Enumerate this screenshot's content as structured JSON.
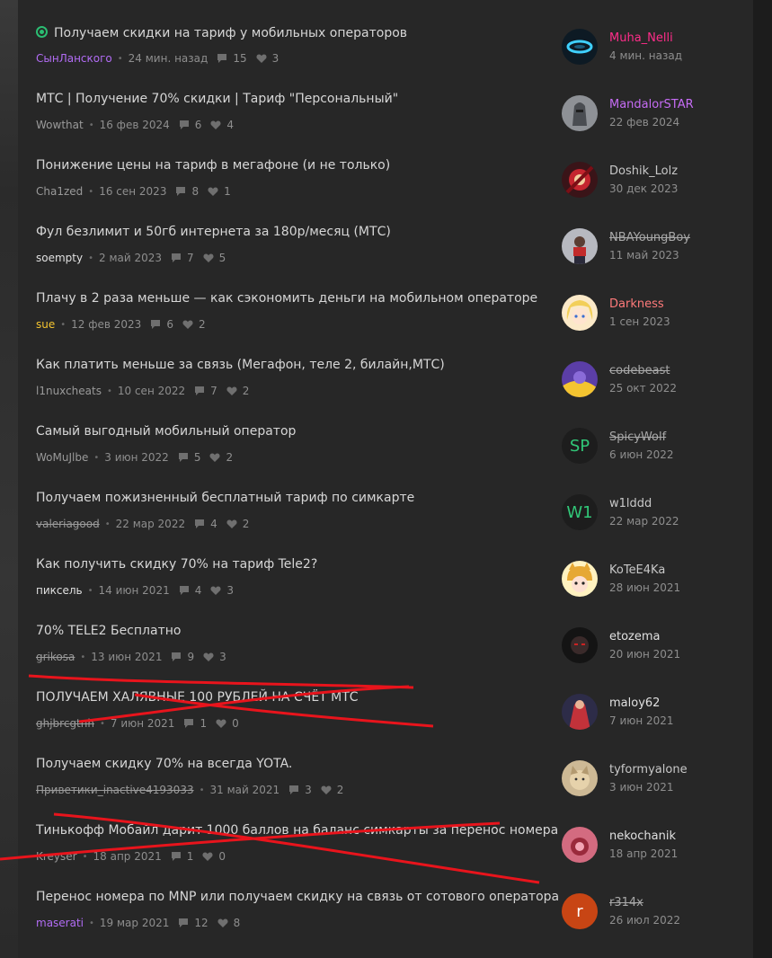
{
  "threads": [
    {
      "title": "Получаем скидки на тариф у мобильных операторов",
      "pinned": true,
      "author": "СынЛанского",
      "author_color": "#b26cf5",
      "author_strike": false,
      "date": "24 мин. назад",
      "replies": "15",
      "likes": "3",
      "last_user": "Muha_Nelli",
      "last_user_color": "#ff2d8a",
      "last_user_strike": false,
      "last_date": "4 мин. назад",
      "avatar": "ring"
    },
    {
      "title": "МТС | Получение 70% скидки | Тариф \"Персональный\"",
      "pinned": false,
      "author": "Wowthat",
      "author_color": "#9a9a9a",
      "author_strike": false,
      "date": "16 фев 2024",
      "replies": "6",
      "likes": "4",
      "last_user": "MandalorSTAR",
      "last_user_color": "#c66cf5",
      "last_user_strike": false,
      "last_date": "22 фев 2024",
      "avatar": "armor"
    },
    {
      "title": "Понижение цены на тариф в мегафоне (и не только)",
      "pinned": false,
      "author": "Cha1zed",
      "author_color": "#9a9a9a",
      "author_strike": false,
      "date": "16 сен 2023",
      "replies": "8",
      "likes": "1",
      "last_user": "Doshik_Lolz",
      "last_user_color": "#c8c8c8",
      "last_user_strike": false,
      "last_date": "30 дек 2023",
      "avatar": "red-art"
    },
    {
      "title": "Фул безлимит и 50гб интернета за 180р/месяц (МТС)",
      "pinned": false,
      "author": "soempty",
      "author_color": "#e0e0e0",
      "author_strike": false,
      "date": "2 май 2023",
      "replies": "7",
      "likes": "5",
      "last_user": "NBAYoungBoy",
      "last_user_color": "#a8a8a8",
      "last_user_strike": true,
      "last_date": "11 май 2023",
      "avatar": "person"
    },
    {
      "title": "Плачу в 2 раза меньше — как сэкономить деньги на мобильном операторе",
      "pinned": false,
      "author": "sue",
      "author_color": "#f4c430",
      "author_strike": false,
      "date": "12 фев 2023",
      "replies": "6",
      "likes": "2",
      "last_user": "Darkness",
      "last_user_color": "#ff7a7a",
      "last_user_strike": false,
      "last_date": "1 сен 2023",
      "avatar": "anime-blonde"
    },
    {
      "title": "Как платить меньше за связь (Мегафон, теле 2, билайн,МТС)",
      "pinned": false,
      "author": "l1nuxcheats",
      "author_color": "#9a9a9a",
      "author_strike": false,
      "date": "10 сен 2022",
      "replies": "7",
      "likes": "2",
      "last_user": "codebeast",
      "last_user_color": "#a8a8a8",
      "last_user_strike": true,
      "last_date": "25 окт 2022",
      "avatar": "purple-yellow"
    },
    {
      "title": "Самый выгодный мобильный оператор",
      "pinned": false,
      "author": "WoMuJlbe",
      "author_color": "#9a9a9a",
      "author_strike": false,
      "date": "3 июн 2022",
      "replies": "5",
      "likes": "2",
      "last_user": "SpicyWolf",
      "last_user_color": "#a8a8a8",
      "last_user_strike": true,
      "last_date": "6 июн 2022",
      "avatar": "SP"
    },
    {
      "title": "Получаем пожизненный бесплатный тариф по симкарте",
      "pinned": false,
      "author": "valeriagood",
      "author_color": "#9a9a9a",
      "author_strike": true,
      "date": "22 мар 2022",
      "replies": "4",
      "likes": "2",
      "last_user": "w1lddd",
      "last_user_color": "#c8c8c8",
      "last_user_strike": false,
      "last_date": "22 мар 2022",
      "avatar": "W1"
    },
    {
      "title": "Как получить скидку 70% на тариф Tele2?",
      "pinned": false,
      "author": "пиксель",
      "author_color": "#e0e0e0",
      "author_strike": false,
      "date": "14 июн 2021",
      "replies": "4",
      "likes": "3",
      "last_user": "KoTeE4Ka",
      "last_user_color": "#c8c8c8",
      "last_user_strike": false,
      "last_date": "28 июн 2021",
      "avatar": "anime-cat"
    },
    {
      "title": "70% TELE2 Бесплатно",
      "pinned": false,
      "author": "grikosa",
      "author_color": "#9a9a9a",
      "author_strike": true,
      "date": "13 июн 2021",
      "replies": "9",
      "likes": "3",
      "last_user": "etozema",
      "last_user_color": "#e0e0e0",
      "last_user_strike": false,
      "last_date": "20 июн 2021",
      "avatar": "dark-face"
    },
    {
      "title": "ПОЛУЧАЕМ ХАЛЯВНЫЕ 100 РУБЛЕЙ НА СЧЁТ МТС",
      "pinned": false,
      "author": "ghjbrcgtnh",
      "author_color": "#9a9a9a",
      "author_strike": true,
      "date": "7 июн 2021",
      "replies": "1",
      "likes": "0",
      "last_user": "maloy62",
      "last_user_color": "#e0e0e0",
      "last_user_strike": false,
      "last_date": "7 июн 2021",
      "avatar": "red-figure"
    },
    {
      "title": "Получаем скидку 70% на всегда YOTA.",
      "pinned": false,
      "author": "Приветики_inactive4193033",
      "author_color": "#9a9a9a",
      "author_strike": true,
      "date": "31 май 2021",
      "replies": "3",
      "likes": "2",
      "last_user": "tyformyalone",
      "last_user_color": "#c8c8c8",
      "last_user_strike": false,
      "last_date": "3 июн 2021",
      "avatar": "beige-cat"
    },
    {
      "title": "Тинькофф Мобайл дарит 1000 баллов на баланс симкарты за перенос номера",
      "pinned": false,
      "author": "Kreyser",
      "author_color": "#9a9a9a",
      "author_strike": false,
      "date": "18 апр 2021",
      "replies": "1",
      "likes": "0",
      "last_user": "nekochanik",
      "last_user_color": "#e0e0e0",
      "last_user_strike": false,
      "last_date": "18 апр 2021",
      "avatar": "pink"
    },
    {
      "title": "Перенос номера по MNP или получаем скидку на связь от сотового оператора",
      "pinned": false,
      "author": "maserati",
      "author_color": "#b26cf5",
      "author_strike": false,
      "date": "19 мар 2021",
      "replies": "12",
      "likes": "8",
      "last_user": "r314x",
      "last_user_color": "#a8a8a8",
      "last_user_strike": true,
      "last_date": "26 июл 2022",
      "avatar": "r"
    }
  ],
  "icons": {
    "replies": "comment-icon",
    "likes": "heart-icon",
    "pinned": "pinned-icon"
  },
  "colors": {
    "background": "#272727",
    "scribble": "#e8141c",
    "pin": "#2bbd72"
  }
}
